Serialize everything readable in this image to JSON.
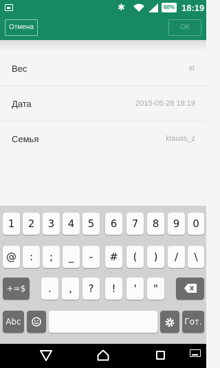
{
  "status_bar": {
    "battery": "60%",
    "time": "18:19"
  },
  "action_bar": {
    "cancel_label": "Отмена",
    "ok_label": "OK"
  },
  "form": {
    "rows": [
      {
        "label": "Вес",
        "value": "кг"
      },
      {
        "label": "Дата",
        "value": "2015-05-28 18:19"
      },
      {
        "label": "Семья",
        "value": "klauss_z"
      }
    ]
  },
  "keyboard": {
    "row1": [
      "1",
      "2",
      "3",
      "4",
      "5",
      "6",
      "7",
      "8",
      "9",
      "0"
    ],
    "row2": [
      "@",
      ":",
      ";",
      "_",
      "-",
      "#",
      "(",
      ")",
      "/",
      "\\"
    ],
    "row3_shift": "+=$",
    "row3": [
      ".",
      ",",
      "?",
      "!",
      "'",
      "\""
    ],
    "row4_abc": "Abc",
    "row4_done": "Гот."
  }
}
